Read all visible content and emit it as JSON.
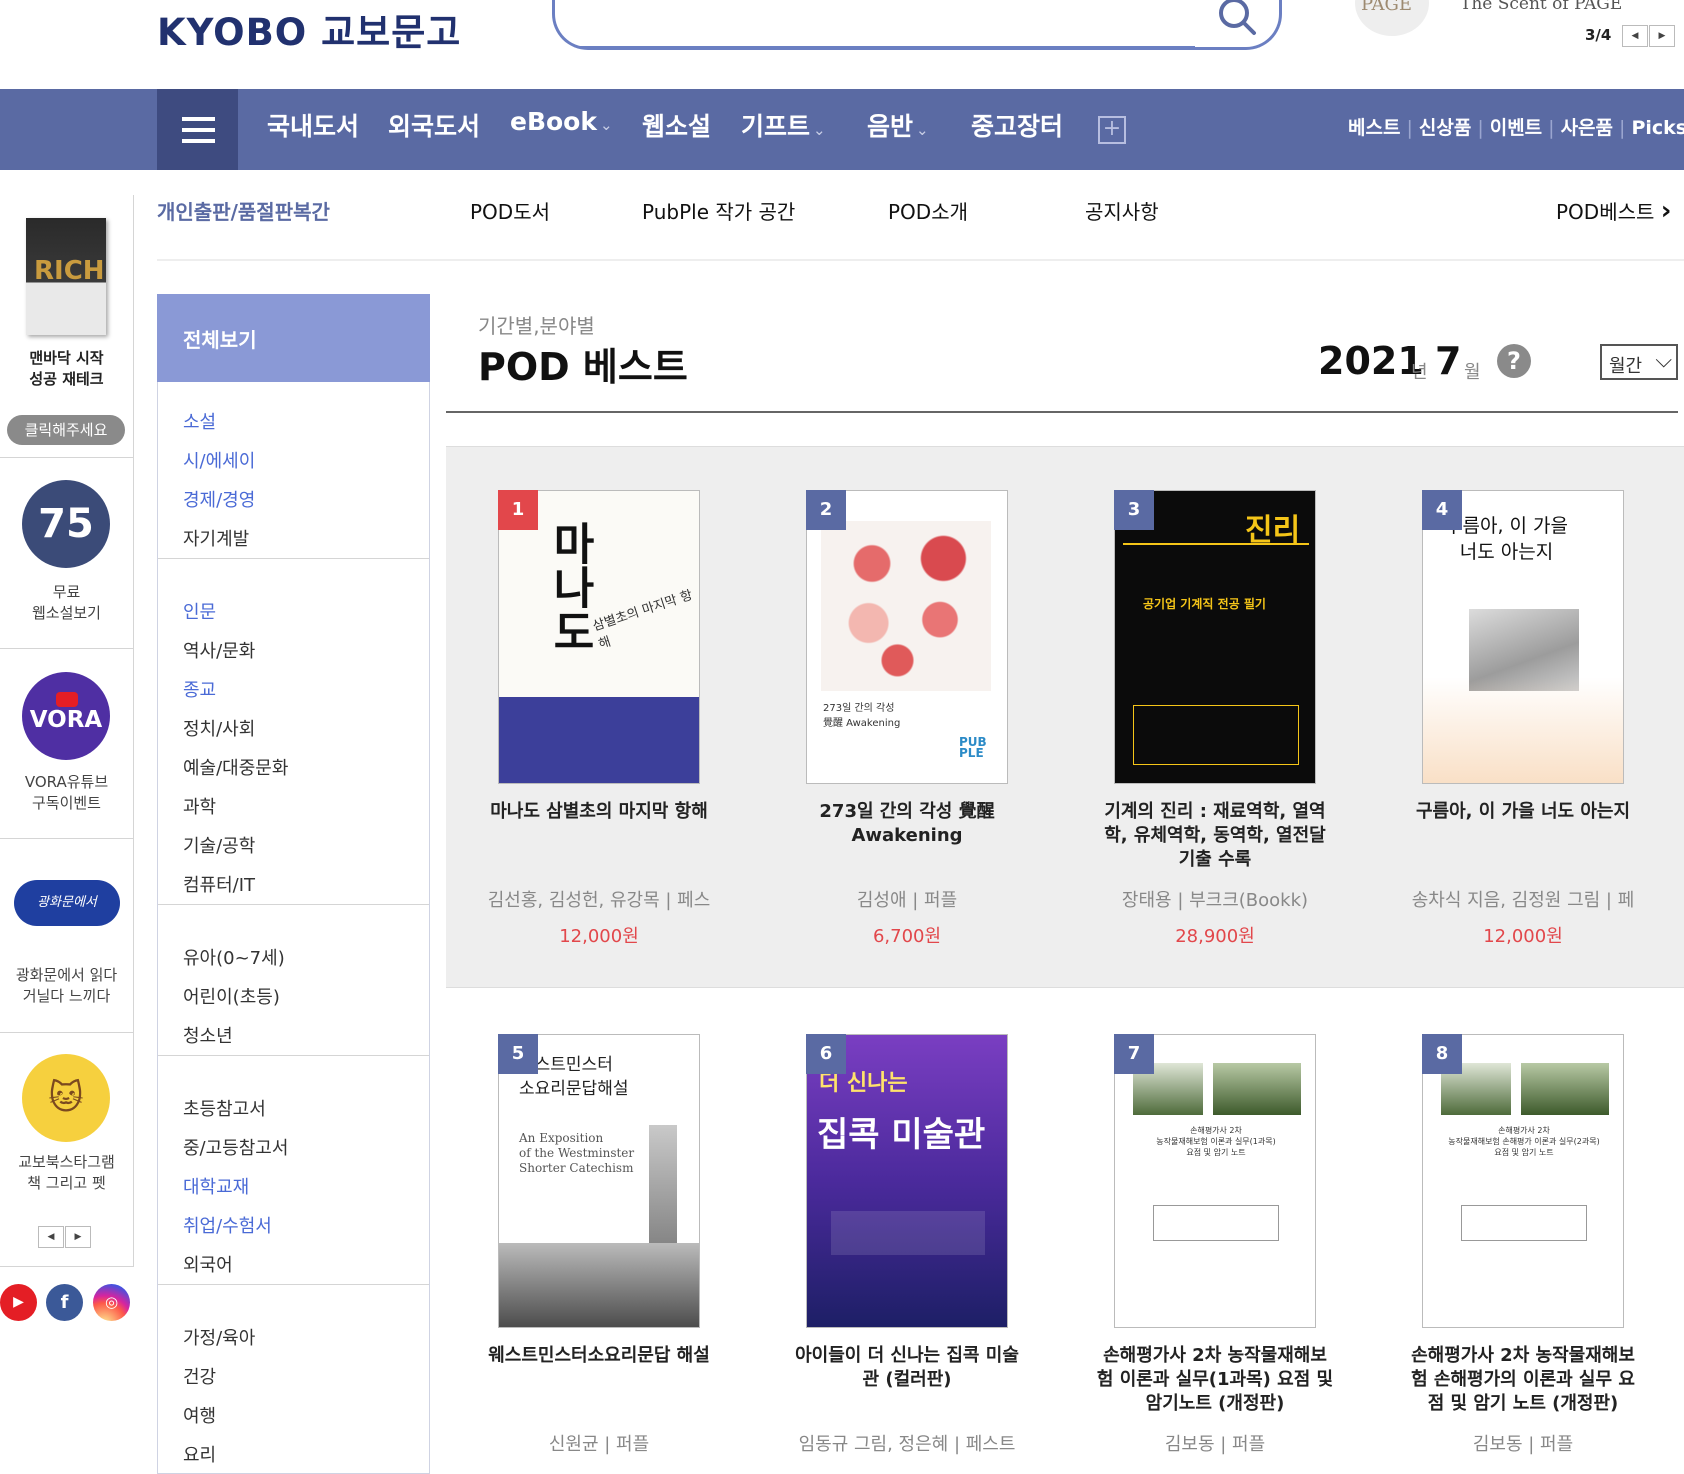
{
  "header": {
    "logo": "KYOBO 교보문고",
    "promo_badge": "PAGE",
    "promo_text": "The Scent of PAGE",
    "pager": "3/4",
    "pager_prev": "◀",
    "pager_next": "▶"
  },
  "gnb": {
    "items": [
      {
        "label": "국내도서",
        "has_dropdown": false
      },
      {
        "label": "외국도서",
        "has_dropdown": false
      },
      {
        "label": "eBook",
        "has_dropdown": true
      },
      {
        "label": "웹소설",
        "has_dropdown": false
      },
      {
        "label": "기프트",
        "has_dropdown": true
      },
      {
        "label": "음반",
        "has_dropdown": true
      },
      {
        "label": "중고장터",
        "has_dropdown": false
      }
    ],
    "chevron": "⌄",
    "plus": "+",
    "right_links": [
      "베스트",
      "신상품",
      "이벤트",
      "사은품",
      "Picks"
    ]
  },
  "rail": {
    "book_text": "RICH",
    "book_caption": "맨바닥 시작\n성공 재테크",
    "click_button": "클릭해주세요",
    "badge_75": "75",
    "caption_75": "무료\n웹소설보기",
    "vora": "VORA",
    "vora_caption": "VORA유튜브\n구독이벤트",
    "gwang_badge": "광화문에서",
    "gwang_caption": "광화문에서 읽다\n거닐다 느끼다",
    "cat_caption": "교보북스타그램\n책 그리고 펫",
    "prev": "◀",
    "next": "▶",
    "social": {
      "youtube": "▶",
      "facebook": "f",
      "instagram": "◎"
    }
  },
  "subnav": {
    "self_publishing": "개인출판/품절판복간",
    "items": [
      "POD도서",
      "PubPle 작가 공간",
      "POD소개",
      "공지사항"
    ],
    "best": "POD베스트",
    "best_arrow": "›"
  },
  "category": {
    "header": "전체보기",
    "groups": [
      [
        {
          "label": "소설",
          "blue": true
        },
        {
          "label": "시/에세이",
          "blue": true
        },
        {
          "label": "경제/경영",
          "blue": true
        },
        {
          "label": "자기계발",
          "blue": false
        }
      ],
      [
        {
          "label": "인문",
          "blue": true
        },
        {
          "label": "역사/문화",
          "blue": false
        },
        {
          "label": "종교",
          "blue": true
        },
        {
          "label": "정치/사회",
          "blue": false
        },
        {
          "label": "예술/대중문화",
          "blue": false
        },
        {
          "label": "과학",
          "blue": false
        },
        {
          "label": "기술/공학",
          "blue": false
        },
        {
          "label": "컴퓨터/IT",
          "blue": false
        }
      ],
      [
        {
          "label": "유아(0~7세)",
          "blue": false
        },
        {
          "label": "어린이(초등)",
          "blue": false
        },
        {
          "label": "청소년",
          "blue": false
        }
      ],
      [
        {
          "label": "초등참고서",
          "blue": false
        },
        {
          "label": "중/고등참고서",
          "blue": false
        },
        {
          "label": "대학교재",
          "blue": true
        },
        {
          "label": "취업/수험서",
          "blue": true
        },
        {
          "label": "외국어",
          "blue": false
        }
      ],
      [
        {
          "label": "가정/육아",
          "blue": false
        },
        {
          "label": "건강",
          "blue": false
        },
        {
          "label": "여행",
          "blue": false
        },
        {
          "label": "요리",
          "blue": false
        }
      ]
    ]
  },
  "main": {
    "subheading": "기간별,분야별",
    "title": "POD 베스트",
    "year": "2021",
    "year_unit": "년",
    "month": "7",
    "month_unit": "월",
    "help": "?",
    "period": "월간",
    "period_chevron": "⌵"
  },
  "books": [
    {
      "rank": "1",
      "title": "마나도 삼별초의 마지막 항해",
      "author": "김선홍, 김성헌, 유강목 | 페스",
      "price": "12,000원",
      "cover": "manado"
    },
    {
      "rank": "2",
      "title": "273일 간의 각성 覺醒 Awakening",
      "author": "김성애 | 퍼플",
      "price": "6,700원",
      "cover": "awakening"
    },
    {
      "rank": "3",
      "title": "기계의 진리 : 재료역학, 열역학, 유체역학, 동역학, 열전달 기출 수록",
      "author": "장태용 | 부크크(Bookk)",
      "price": "28,900원",
      "cover": "truth"
    },
    {
      "rank": "4",
      "title": "구름아, 이 가을 너도 아는지",
      "author": "송차식 지음, 김정원 그림 | 페",
      "price": "12,000원",
      "cover": "cloud"
    },
    {
      "rank": "5",
      "title": "웨스트민스터소요리문답 해설",
      "author": "신원균 | 퍼플",
      "price": "",
      "cover": "westminster"
    },
    {
      "rank": "6",
      "title": "아이들이 더 신나는 집콕 미술관 (컬러판)",
      "author": "임동규 그림, 정은혜 | 페스트",
      "price": "",
      "cover": "art"
    },
    {
      "rank": "7",
      "title": "손해평가사 2차 농작물재해보험 이론과 실무(1과목) 요점 및 암기노트 (개정판)",
      "author": "김보동 | 퍼플",
      "price": "",
      "cover": "damage1"
    },
    {
      "rank": "8",
      "title": "손해평가사 2차 농작물재해보험 손해평가의 이론과 실무 요점 및 암기 노트 (개정판)",
      "author": "김보동 | 퍼플",
      "price": "",
      "cover": "damage2"
    }
  ],
  "covers": {
    "manado_title": "마나도",
    "manado_sub": "삼별초의 마지막 항해",
    "awakening": "273일 간의 각성\n覺醒 Awakening",
    "pubple": "PUB\nPLE",
    "truth_title": "진리",
    "truth_sub": "공기업 기계직 전공 필기",
    "cloud_title": "구름아, 이 가을\n너도 아는지",
    "west_title": "웨스트민스터\n소요리문답해설",
    "west_en": "An Exposition\nof the Westminster\nShorter Catechism",
    "art_top": "더 신나는",
    "art_title": "집콕 미술관",
    "damage1_text": "손해평가사 2차\n농작물재해보험 이론과 실무(1과목)\n요점 및 암기 노트",
    "damage2_text": "손해평가사 2차\n농작물재해보험 손해평가 이론과 실무(2과목)\n요점 및 암기 노트"
  }
}
